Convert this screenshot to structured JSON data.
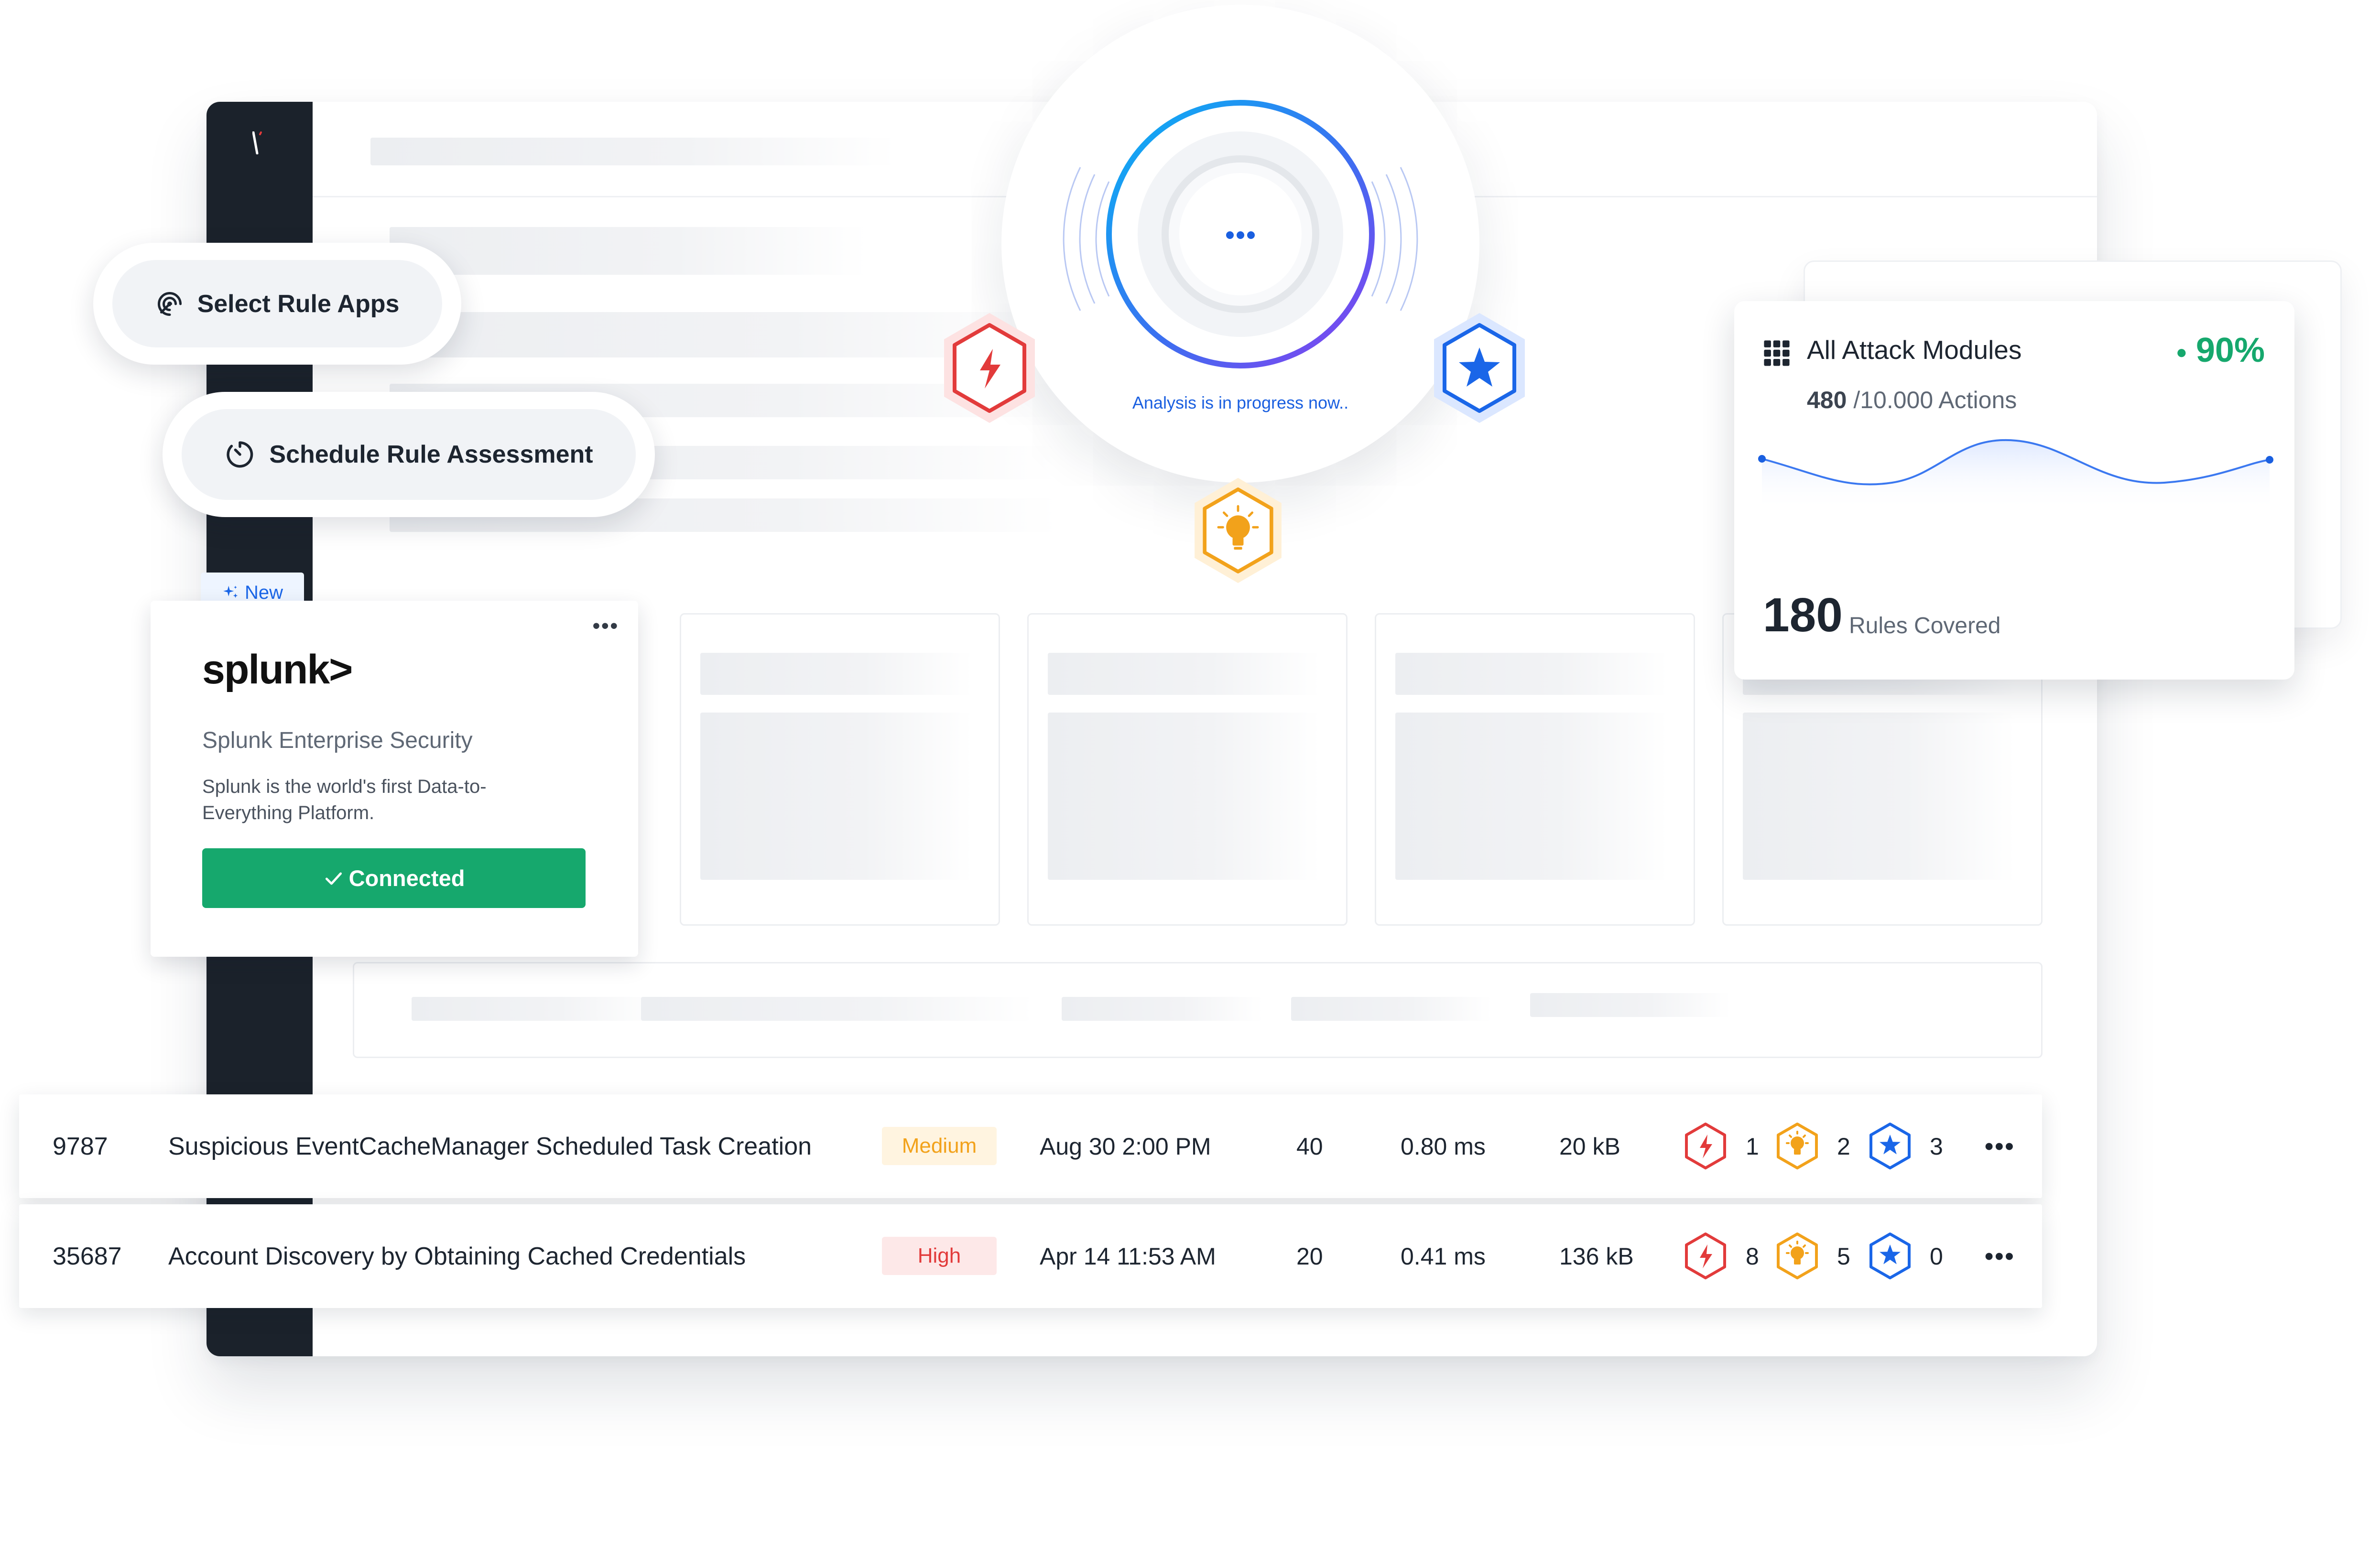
{
  "pills": {
    "select_rule_apps": "Select Rule Apps",
    "schedule_rule_assessment": "Schedule Rule Assessment"
  },
  "integration_card": {
    "badge": "New",
    "logo_text": "splunk>",
    "title": "Splunk Enterprise Security",
    "description": "Splunk is the world's first Data-to-Everything Platform.",
    "status_button": "Connected"
  },
  "analysis": {
    "status": "Analysis is in progress now.."
  },
  "attack_modules": {
    "title": "All Attack Modules",
    "percent": "90%",
    "actions_count": "480",
    "actions_total": "/10.000 Actions",
    "rules_count": "180",
    "rules_label": "Rules Covered"
  },
  "rows": [
    {
      "id": "9787",
      "name": "Suspicious EventCacheManager Scheduled Task Creation",
      "severity": "Medium",
      "date": "Aug 30 2:00 PM",
      "count": "40",
      "duration": "0.80 ms",
      "size": "20 kB",
      "red": "1",
      "orange": "2",
      "blue": "3"
    },
    {
      "id": "35687",
      "name": "Account Discovery by Obtaining Cached Credentials",
      "severity": "High",
      "date": "Apr 14 11:53 AM",
      "count": "20",
      "duration": "0.41 ms",
      "size": "136 kB",
      "red": "8",
      "orange": "5",
      "blue": "0"
    }
  ],
  "colors": {
    "sidebar": "#1b222b",
    "success": "#16a86d",
    "accent_blue": "#1a66e8",
    "alert_red": "#e23b3b",
    "warning_orange": "#f2a21b"
  },
  "icons": [
    "spiral-icon",
    "timer-icon",
    "sparkle-icon",
    "check-icon",
    "more-icon",
    "bolt-hexagon-icon",
    "bulb-hexagon-icon",
    "star-hexagon-icon",
    "grid-icon"
  ]
}
